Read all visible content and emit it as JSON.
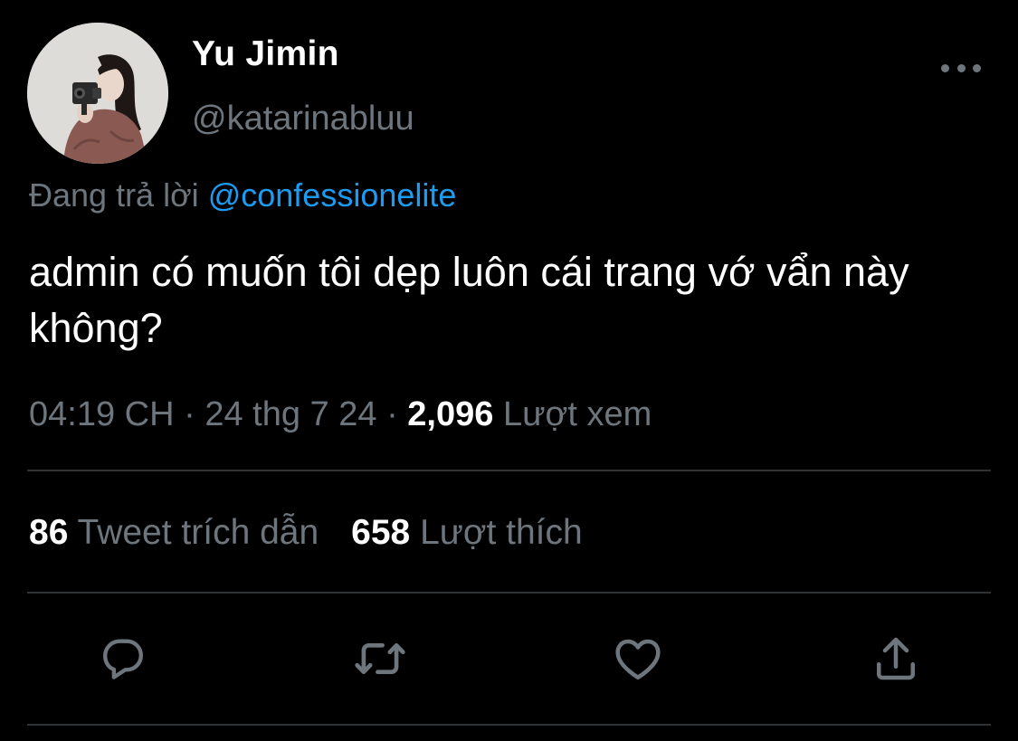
{
  "tweet": {
    "author": {
      "display_name": "Yu Jimin",
      "handle": "@katarinabluu"
    },
    "reply_prefix": "Đang trả lời",
    "reply_to": "@confessionelite",
    "text": "admin có muốn tôi dẹp luôn cái trang vớ vẩn này không?",
    "time": "04:19 CH",
    "separator": "·",
    "date": "24 thg 7 24",
    "views_count": "2,096",
    "views_label": "Lượt xem",
    "quote_count": "86",
    "quote_label": "Tweet trích dẫn",
    "like_count": "658",
    "like_label": "Lượt thích"
  },
  "icons": {
    "avatar": "profile-photo",
    "more": "more-horizontal-icon",
    "reply": "reply-icon",
    "retweet": "retweet-icon",
    "like": "heart-icon",
    "share": "share-icon"
  },
  "colors": {
    "background": "#000000",
    "primary_text": "#ffffff",
    "secondary_text": "#6e767d",
    "accent": "#1d9bf0",
    "divider": "#2f3336"
  }
}
